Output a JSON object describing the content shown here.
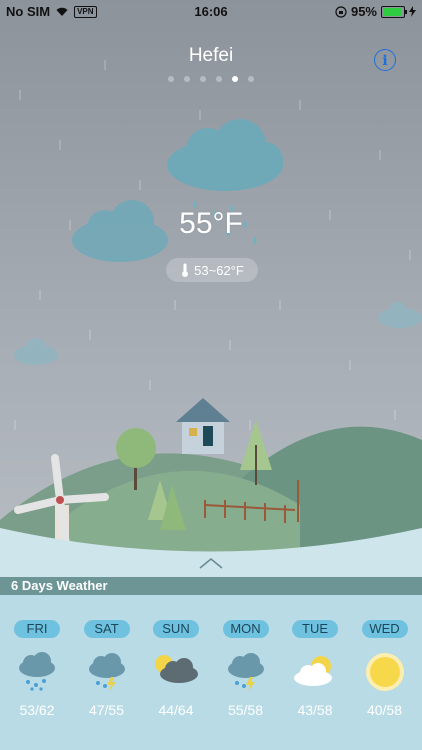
{
  "status_bar": {
    "carrier": "No SIM",
    "vpn": "VPN",
    "time": "16:06",
    "battery": "95%",
    "battery_level": 0.95
  },
  "city": "Hefei",
  "page_dots": {
    "count": 6,
    "active_index": 4
  },
  "info_button": "i",
  "current": {
    "temperature": "55°F",
    "range": "53~62°F"
  },
  "section_title": "6 Days Weather",
  "forecast": [
    {
      "day": "FRI",
      "icon": "rain-cloud-icon",
      "temps": "53/62"
    },
    {
      "day": "SAT",
      "icon": "thunder-rain-cloud-icon",
      "temps": "47/55"
    },
    {
      "day": "SUN",
      "icon": "sun-dark-cloud-icon",
      "temps": "44/64"
    },
    {
      "day": "MON",
      "icon": "thunder-rain-cloud-icon",
      "temps": "55/58"
    },
    {
      "day": "TUE",
      "icon": "partly-cloudy-icon",
      "temps": "43/58"
    },
    {
      "day": "WED",
      "icon": "sun-icon",
      "temps": "40/58"
    }
  ]
}
